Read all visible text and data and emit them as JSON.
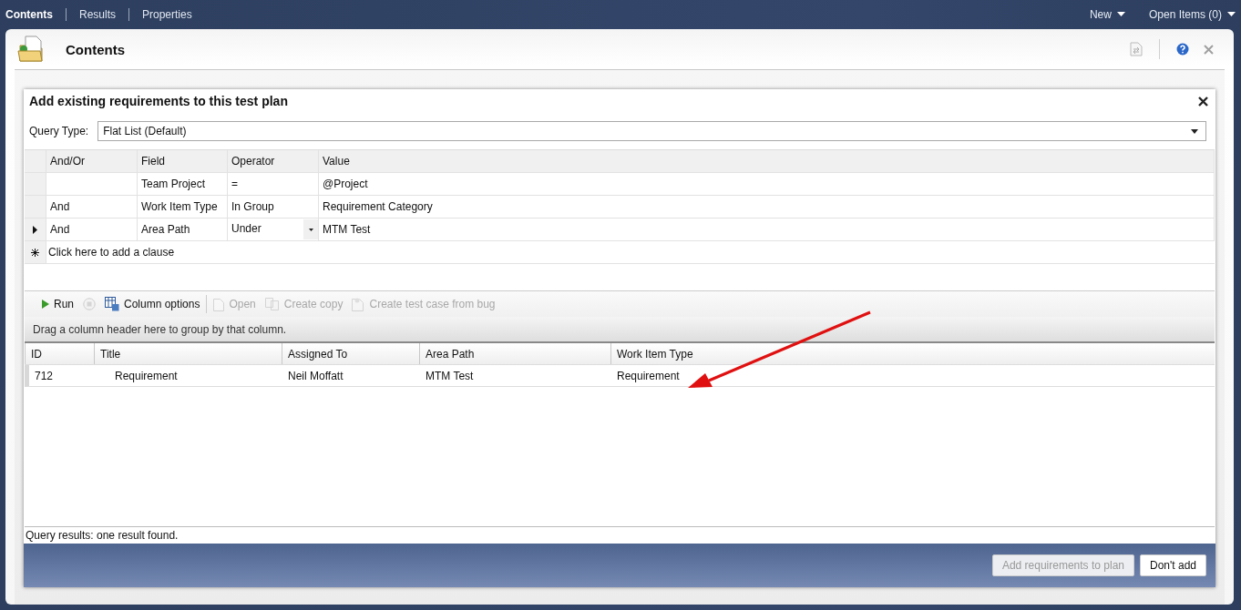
{
  "nav": {
    "tabs": [
      {
        "label": "Contents",
        "selected": true
      },
      {
        "label": "Results",
        "selected": false
      },
      {
        "label": "Properties",
        "selected": false
      }
    ],
    "menus": [
      "New",
      "Open Items (0)"
    ]
  },
  "page": {
    "title": "Contents"
  },
  "dialog": {
    "title": "Add existing requirements to this test plan",
    "query_type": {
      "label": "Query Type:",
      "value": "Flat List (Default)"
    },
    "clauses": {
      "columns": [
        "And/Or",
        "Field",
        "Operator",
        "Value"
      ],
      "rows": [
        {
          "field": "Team Project",
          "operator": "=",
          "value": "@Project",
          "current": false
        },
        {
          "and_or": "And",
          "field": "Work Item Type",
          "operator": "In Group",
          "value": "Requirement Category",
          "current": false
        },
        {
          "and_or": "And",
          "field": "Area Path",
          "operator": "Under",
          "value": "MTM Test",
          "current": true
        }
      ],
      "add_clause": "Click here to add a clause"
    },
    "toolbar": [
      {
        "kind": "run",
        "label": "Run",
        "disabled": false
      },
      {
        "kind": "stop",
        "disabled": true
      },
      {
        "kind": "columns",
        "label": "Column options",
        "disabled": false
      },
      {
        "kind": "open",
        "label": "Open",
        "disabled": true
      },
      {
        "kind": "copy",
        "label": "Create copy",
        "disabled": true
      },
      {
        "kind": "bug",
        "label": "Create test case from bug",
        "disabled": true
      }
    ],
    "group_hint": "Drag a column header here to group by that column.",
    "results": {
      "columns": [
        "ID",
        "Title",
        "Assigned To",
        "Area Path",
        "Work Item Type"
      ],
      "rows": [
        {
          "cells": [
            "712",
            "Requirement",
            "Neil Moffatt",
            "MTM Test",
            "Requirement"
          ],
          "selected": true
        }
      ]
    },
    "status": "Query results: one result found.",
    "buttons": [
      {
        "label": "Add requirements to plan",
        "disabled": true
      },
      {
        "label": "Don't add",
        "disabled": false
      }
    ]
  }
}
